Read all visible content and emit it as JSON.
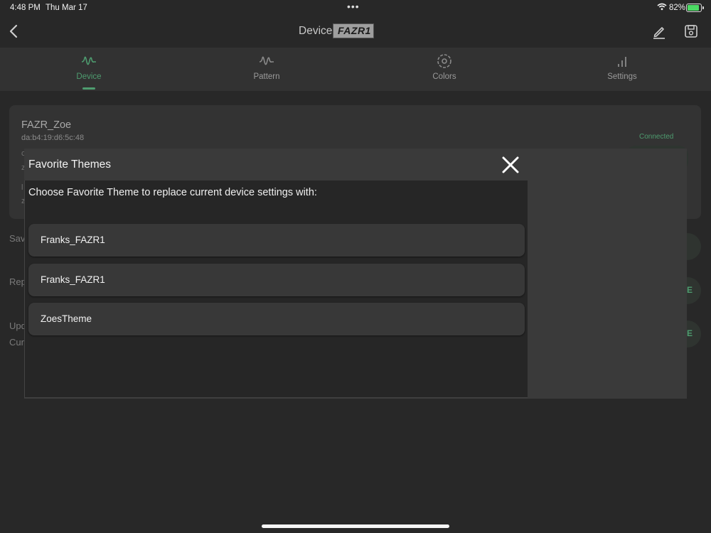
{
  "status_bar": {
    "time": "4:48 PM",
    "date": "Thu Mar 17",
    "dots": "•••",
    "battery_pct": "82%",
    "battery_level": 0.82
  },
  "nav": {
    "title": "Device",
    "logo_text": "FAZR1"
  },
  "tabs": [
    {
      "label": "Device",
      "icon": "waveform-icon",
      "active": true
    },
    {
      "label": "Pattern",
      "icon": "pattern-icon",
      "active": false
    },
    {
      "label": "Colors",
      "icon": "colors-icon",
      "active": false
    },
    {
      "label": "Settings",
      "icon": "bar-chart-icon",
      "active": false
    }
  ],
  "device_card": {
    "name": "FAZR_Zoe",
    "mac": "da:b4:19:d6:5c:48",
    "status": "Connected"
  },
  "background_rows": {
    "save_label": "Sav",
    "replace_label": "Rep",
    "update_label": "Upd",
    "current_label": "Cur",
    "btn_e_1": "E",
    "btn_e_2": "E"
  },
  "modal": {
    "title": "Favorite Themes",
    "message": "Choose Favorite Theme to replace current device settings with:",
    "themes": [
      {
        "name": "Franks_FAZR1"
      },
      {
        "name": "Franks_FAZR1"
      },
      {
        "name": "ZoesTheme"
      }
    ]
  },
  "colors": {
    "accent": "#4e9c6f",
    "background": "#282828"
  }
}
